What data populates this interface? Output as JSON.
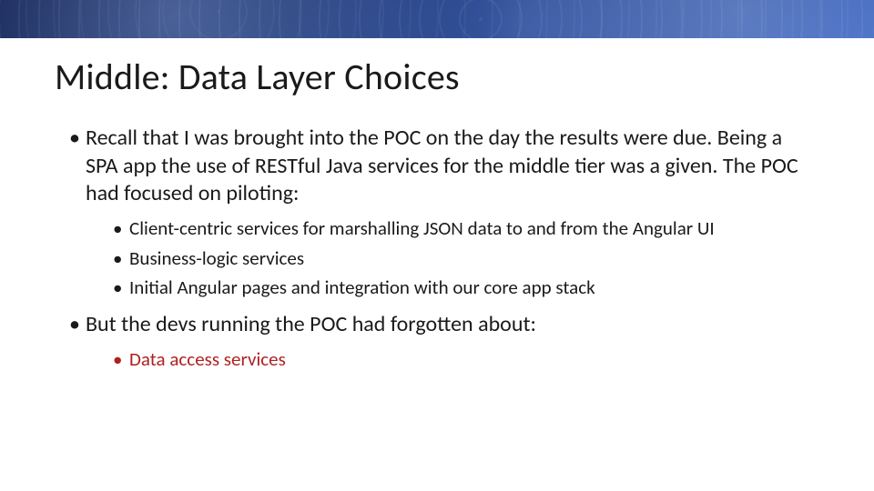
{
  "slide": {
    "title": "Middle: Data Layer Choices",
    "bullets": [
      {
        "text": "Recall that I was brought into the POC on the day the results were due. Being a SPA app the use of RESTful Java services for the middle tier was a given. The POC had focused on piloting:",
        "children": [
          {
            "text": "Client-centric services for marshalling JSON data to and from the Angular UI",
            "emph": false
          },
          {
            "text": "Business-logic services",
            "emph": false
          },
          {
            "text": "Initial Angular pages and integration with our core app stack",
            "emph": false
          }
        ]
      },
      {
        "text": "But the devs running the POC had forgotten about:",
        "children": [
          {
            "text": "Data access services",
            "emph": true
          }
        ]
      }
    ]
  }
}
